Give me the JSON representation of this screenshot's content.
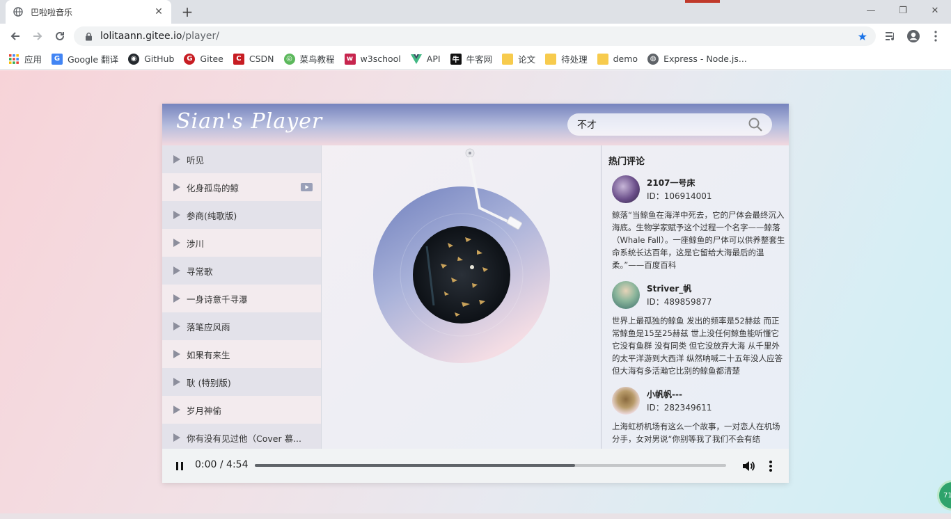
{
  "browser": {
    "tab_title": "巴啦啦音乐",
    "url_host": "lolitaann.gitee.io",
    "url_path": "/player/",
    "bookmarks": [
      {
        "label": "应用",
        "icon": "apps-grid-icon"
      },
      {
        "label": "Google 翻译",
        "icon": "google-translate-icon"
      },
      {
        "label": "GitHub",
        "icon": "github-icon"
      },
      {
        "label": "Gitee",
        "icon": "gitee-icon"
      },
      {
        "label": "CSDN",
        "icon": "csdn-icon"
      },
      {
        "label": "菜鸟教程",
        "icon": "runoob-icon"
      },
      {
        "label": "w3school",
        "icon": "w3school-icon"
      },
      {
        "label": "API",
        "icon": "vue-icon"
      },
      {
        "label": "牛客网",
        "icon": "nowcoder-icon"
      },
      {
        "label": "论文",
        "icon": "folder-icon"
      },
      {
        "label": "待处理",
        "icon": "folder-icon"
      },
      {
        "label": "demo",
        "icon": "folder-icon"
      },
      {
        "label": "Express - Node.js...",
        "icon": "globe-icon"
      }
    ]
  },
  "player": {
    "logo": "Sian's Player",
    "search_value": "不才",
    "songs": [
      {
        "title": "听见",
        "mv": false
      },
      {
        "title": "化身孤岛的鲸",
        "mv": true
      },
      {
        "title": "参商(纯歌版)",
        "mv": false
      },
      {
        "title": "涉川",
        "mv": false
      },
      {
        "title": "寻常歌",
        "mv": false
      },
      {
        "title": "一身诗意千寻瀑",
        "mv": false
      },
      {
        "title": "落笔应风雨",
        "mv": false
      },
      {
        "title": "如果有来生",
        "mv": false
      },
      {
        "title": "耿 (特别版)",
        "mv": false
      },
      {
        "title": "岁月神偷",
        "mv": false
      },
      {
        "title": "你有没有见过他（Cover 慕...",
        "mv": false
      }
    ],
    "comments_title": "热门评论",
    "comments": [
      {
        "name": "2107一号床",
        "id": "ID：106914001",
        "text": "鲸落“当鲸鱼在海洋中死去，它的尸体会最终沉入海底。生物学家赋予这个过程一个名字——鲸落（Whale Fall）。一座鲸鱼的尸体可以供养整套生命系统长达百年，这是它留给大海最后的温柔。”——百度百科"
      },
      {
        "name": "Striver_帆",
        "id": "ID：489859877",
        "text": "世界上最孤独的鲸鱼 发出的频率是52赫兹 而正常鲸鱼是15至25赫兹 世上没任何鲸鱼能听懂它 它没有鱼群 没有同类 但它没放弃大海 从千里外的太平洋游到大西洋 纵然呐喊二十五年没人应答 但大海有多活瀚它比别的鲸鱼都清楚"
      },
      {
        "name": "小帆帆---",
        "id": "ID：282349611",
        "text": "上海虹桥机场有这么一个故事，一对恋人在机场分手，女对男说“你别等我了我们不会有结"
      }
    ],
    "audio": {
      "time": "0:00 / 4:54",
      "progress": 0.68
    }
  },
  "colors": {
    "header_start": "#7684bd",
    "header_end": "#f1d8df",
    "bookmark_star": "#1a73e8"
  }
}
